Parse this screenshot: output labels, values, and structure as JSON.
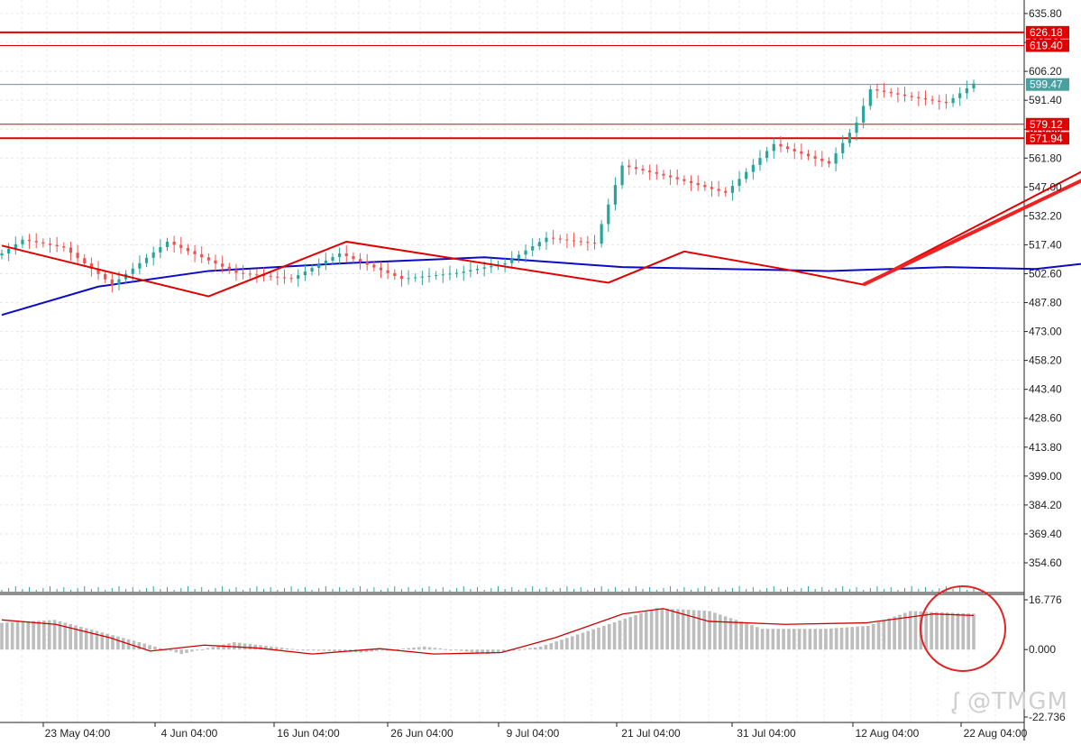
{
  "watermark": "@TMGM",
  "watermark_logo": "TMGM-logo-icon",
  "chart_data": [
    {
      "type": "candlestick",
      "title": "",
      "ylim": [
        345,
        641
      ],
      "y_ticks": [
        "635.80",
        "621.00",
        "606.20",
        "591.40",
        "576.60",
        "561.80",
        "547.00",
        "532.20",
        "517.40",
        "502.60",
        "487.80",
        "473.00",
        "458.20",
        "443.40",
        "428.60",
        "413.80",
        "399.00",
        "384.20",
        "369.40",
        "354.60"
      ],
      "x_ticks": [
        "23 May 04:00",
        "4 Jun 04:00",
        "16 Jun 04:00",
        "26 Jun 04:00",
        "9 Jul 04:00",
        "21 Jul 04:00",
        "31 Jul 04:00",
        "12 Aug 04:00",
        "22 Aug 04:00"
      ],
      "bull_color": "#26a69a",
      "bear_color": "#ef5350",
      "price_segments": [
        {
          "bars": 3,
          "from": 513,
          "to": 520
        },
        {
          "bars": 6,
          "from": 520,
          "to": 516
        },
        {
          "bars": 7,
          "from": 516,
          "to": 497
        },
        {
          "bars": 8,
          "from": 497,
          "to": 519
        },
        {
          "bars": 10,
          "from": 519,
          "to": 503
        },
        {
          "bars": 8,
          "from": 503,
          "to": 500
        },
        {
          "bars": 7,
          "from": 500,
          "to": 513
        },
        {
          "bars": 9,
          "from": 513,
          "to": 500
        },
        {
          "bars": 8,
          "from": 500,
          "to": 503
        },
        {
          "bars": 7,
          "from": 503,
          "to": 508
        },
        {
          "bars": 6,
          "from": 508,
          "to": 521
        },
        {
          "bars": 7,
          "from": 521,
          "to": 518
        },
        {
          "bars": 4,
          "from": 518,
          "to": 558
        },
        {
          "bars": 7,
          "from": 558,
          "to": 552
        },
        {
          "bars": 8,
          "from": 552,
          "to": 544
        },
        {
          "bars": 7,
          "from": 544,
          "to": 569
        },
        {
          "bars": 8,
          "from": 569,
          "to": 559
        },
        {
          "bars": 4,
          "from": 559,
          "to": 580
        },
        {
          "bars": 2,
          "from": 580,
          "to": 597
        },
        {
          "bars": 6,
          "from": 597,
          "to": 593
        },
        {
          "bars": 5,
          "from": 593,
          "to": 590
        },
        {
          "bars": 4,
          "from": 590,
          "to": 600
        }
      ],
      "moving_average": {
        "color": "#0a0ac8",
        "points": [
          [
            0,
            481.5
          ],
          [
            14,
            496
          ],
          [
            30,
            504
          ],
          [
            50,
            508
          ],
          [
            70,
            511
          ],
          [
            90,
            506
          ],
          [
            105,
            505
          ],
          [
            120,
            504
          ],
          [
            137,
            506
          ],
          [
            150,
            505
          ],
          [
            165,
            511
          ],
          [
            180,
            519
          ],
          [
            195,
            524
          ],
          [
            206,
            530
          ],
          [
            217,
            538
          ],
          [
            230,
            549
          ],
          [
            242,
            557
          ],
          [
            252,
            565
          ]
        ]
      },
      "horizontal_levels": [
        {
          "label": "626.18",
          "value": 626.18,
          "color": "#e00000",
          "thick": true
        },
        {
          "label": "619.40",
          "value": 619.4,
          "color": "#e00000",
          "thick": false
        },
        {
          "label": "579.12",
          "value": 579.12,
          "color": "#e00000",
          "thick": false
        },
        {
          "label": "571.94",
          "value": 571.94,
          "color": "#e00000",
          "thick": true
        },
        {
          "label": "599.47",
          "value": 599.47,
          "color": "#48a0a0",
          "thick": false,
          "current": true
        }
      ],
      "zigzag": [
        [
          0,
          517
        ],
        [
          30,
          491
        ],
        [
          50,
          519
        ],
        [
          88,
          498
        ],
        [
          99,
          514
        ],
        [
          115,
          504
        ],
        [
          125,
          497
        ],
        [
          160,
          561
        ],
        [
          189,
          532
        ],
        [
          211,
          547
        ],
        [
          230,
          570
        ],
        [
          249,
          604
        ],
        [
          251,
          599
        ]
      ],
      "annotations": [
        {
          "from": [
            125,
            497
          ],
          "to": [
            163,
            561
          ],
          "kind": "arrow"
        },
        {
          "from": [
            168,
            560
          ],
          "to": [
            196,
            530
          ],
          "kind": "arrow"
        },
        {
          "from": [
            199,
            532
          ],
          "to": [
            231,
            567
          ],
          "kind": "line"
        },
        {
          "from": [
            222,
            552
          ],
          "to": [
            246,
            604
          ],
          "kind": "arrow"
        },
        {
          "from": [
            246,
            597
          ],
          "to": [
            252,
            578
          ],
          "kind": "arrow"
        },
        {
          "from": [
            254,
            580
          ],
          "to": [
            263,
            624
          ],
          "kind": "arrow"
        }
      ]
    },
    {
      "type": "histogram",
      "title": "",
      "ylim": [
        -22.736,
        16.776
      ],
      "y_ticks": [
        "16.776",
        "0.000",
        "-22.736"
      ],
      "bar_color": "#bdbdbd",
      "signal_color": "#cc0000",
      "segments": [
        {
          "bars": 10,
          "from": 9,
          "to": 10
        },
        {
          "bars": 15,
          "from": 10,
          "to": 3
        },
        {
          "bars": 9,
          "from": 3,
          "to": -1.5
        },
        {
          "bars": 10,
          "from": -1.5,
          "to": 2.5
        },
        {
          "bars": 12,
          "from": 2.5,
          "to": 0
        },
        {
          "bars": 12,
          "from": 0,
          "to": -1
        },
        {
          "bars": 12,
          "from": -1,
          "to": 1
        },
        {
          "bars": 12,
          "from": 1,
          "to": -1.5
        },
        {
          "bars": 10,
          "from": -1.5,
          "to": 1
        },
        {
          "bars": 12,
          "from": 1,
          "to": 8
        },
        {
          "bars": 10,
          "from": 8,
          "to": 14
        },
        {
          "bars": 10,
          "from": 14,
          "to": 13
        },
        {
          "bars": 10,
          "from": 13,
          "to": 7
        },
        {
          "bars": 12,
          "from": 7,
          "to": 7
        },
        {
          "bars": 8,
          "from": 7,
          "to": 8
        },
        {
          "bars": 8,
          "from": 8,
          "to": 13
        },
        {
          "bars": 13,
          "from": 13,
          "to": 12
        }
      ],
      "signal_points": [
        [
          0,
          10
        ],
        [
          20,
          8.5
        ],
        [
          40,
          4
        ],
        [
          55,
          -0.5
        ],
        [
          75,
          1.5
        ],
        [
          95,
          0.5
        ],
        [
          115,
          -1.5
        ],
        [
          140,
          0.3
        ],
        [
          160,
          -1.5
        ],
        [
          185,
          -1
        ],
        [
          205,
          4
        ],
        [
          230,
          12
        ],
        [
          245,
          13.8
        ],
        [
          262,
          9.5
        ],
        [
          290,
          8.5
        ],
        [
          320,
          9
        ],
        [
          345,
          12
        ],
        [
          360,
          11.5
        ]
      ],
      "highlight": {
        "shape": "circle",
        "kind": "annotation"
      }
    }
  ]
}
